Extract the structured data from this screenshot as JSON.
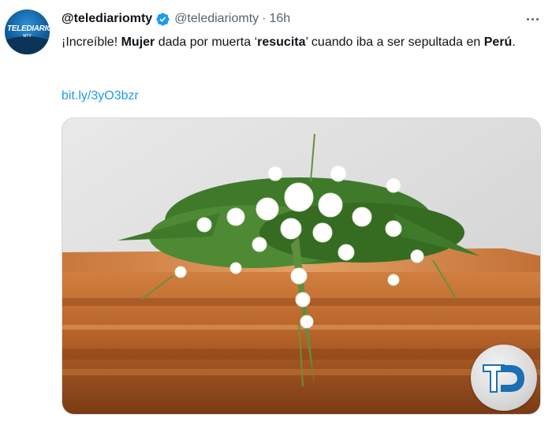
{
  "tweet": {
    "display_name": "@telediariomty",
    "handle": "@telediariomty",
    "separator": "·",
    "timestamp": "16h",
    "text": {
      "part1": "¡Increíble! ",
      "bold1": "Mujer",
      "part2": " dada por muerta ",
      "quote_open": "‘",
      "bold2": "resucita",
      "quote_close": "’",
      "part3": " cuando iba a ser sepultada en ",
      "bold3": "Perú",
      "part4": "."
    },
    "link": "bit.ly/3yO3bzr",
    "avatar": {
      "logo_text": "TELEDIARIO",
      "logo_sub": "MTY"
    },
    "media": {
      "alt": "",
      "watermark_logo": "TD"
    }
  },
  "icons": {
    "verified": "verified-badge-icon",
    "more": "more-options-icon"
  },
  "colors": {
    "link": "#1d9bf0",
    "verified": "#1d9bf0",
    "secondary_text": "#536471",
    "primary_text": "#0f1419",
    "watermark_blue": "#1a6fb5"
  }
}
